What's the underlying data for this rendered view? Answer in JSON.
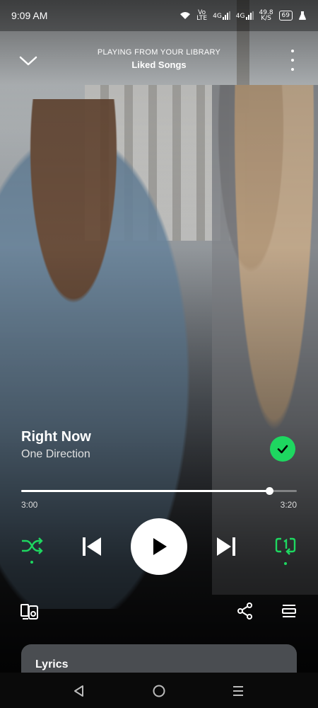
{
  "status_bar": {
    "time": "9:09 AM",
    "network_speed": "49.8",
    "network_speed_unit": "K/S",
    "battery": "69",
    "volte": "Vo",
    "lte": "LTE",
    "sig1": "4G",
    "sig2": "4G"
  },
  "header": {
    "context_label": "PLAYING FROM YOUR LIBRARY",
    "context_name": "Liked Songs"
  },
  "track": {
    "title": "Right Now",
    "artist": "One Direction",
    "liked": true
  },
  "playback": {
    "elapsed": "3:00",
    "duration": "3:20",
    "progress_fraction": 0.9,
    "shuffle_on": true,
    "repeat_mode": "one",
    "state": "paused"
  },
  "lyrics": {
    "label": "Lyrics"
  },
  "colors": {
    "accent": "#1ed760",
    "lyrics_card": "#4a4d51"
  },
  "icons": {
    "collapse": "chevron-down-icon",
    "more": "more-vertical-icon",
    "liked": "check-circle-icon",
    "shuffle": "shuffle-icon",
    "previous": "skip-previous-icon",
    "play": "play-icon",
    "next": "skip-next-icon",
    "repeat": "repeat-one-icon",
    "devices": "connect-device-icon",
    "share": "share-icon",
    "queue": "queue-icon"
  }
}
